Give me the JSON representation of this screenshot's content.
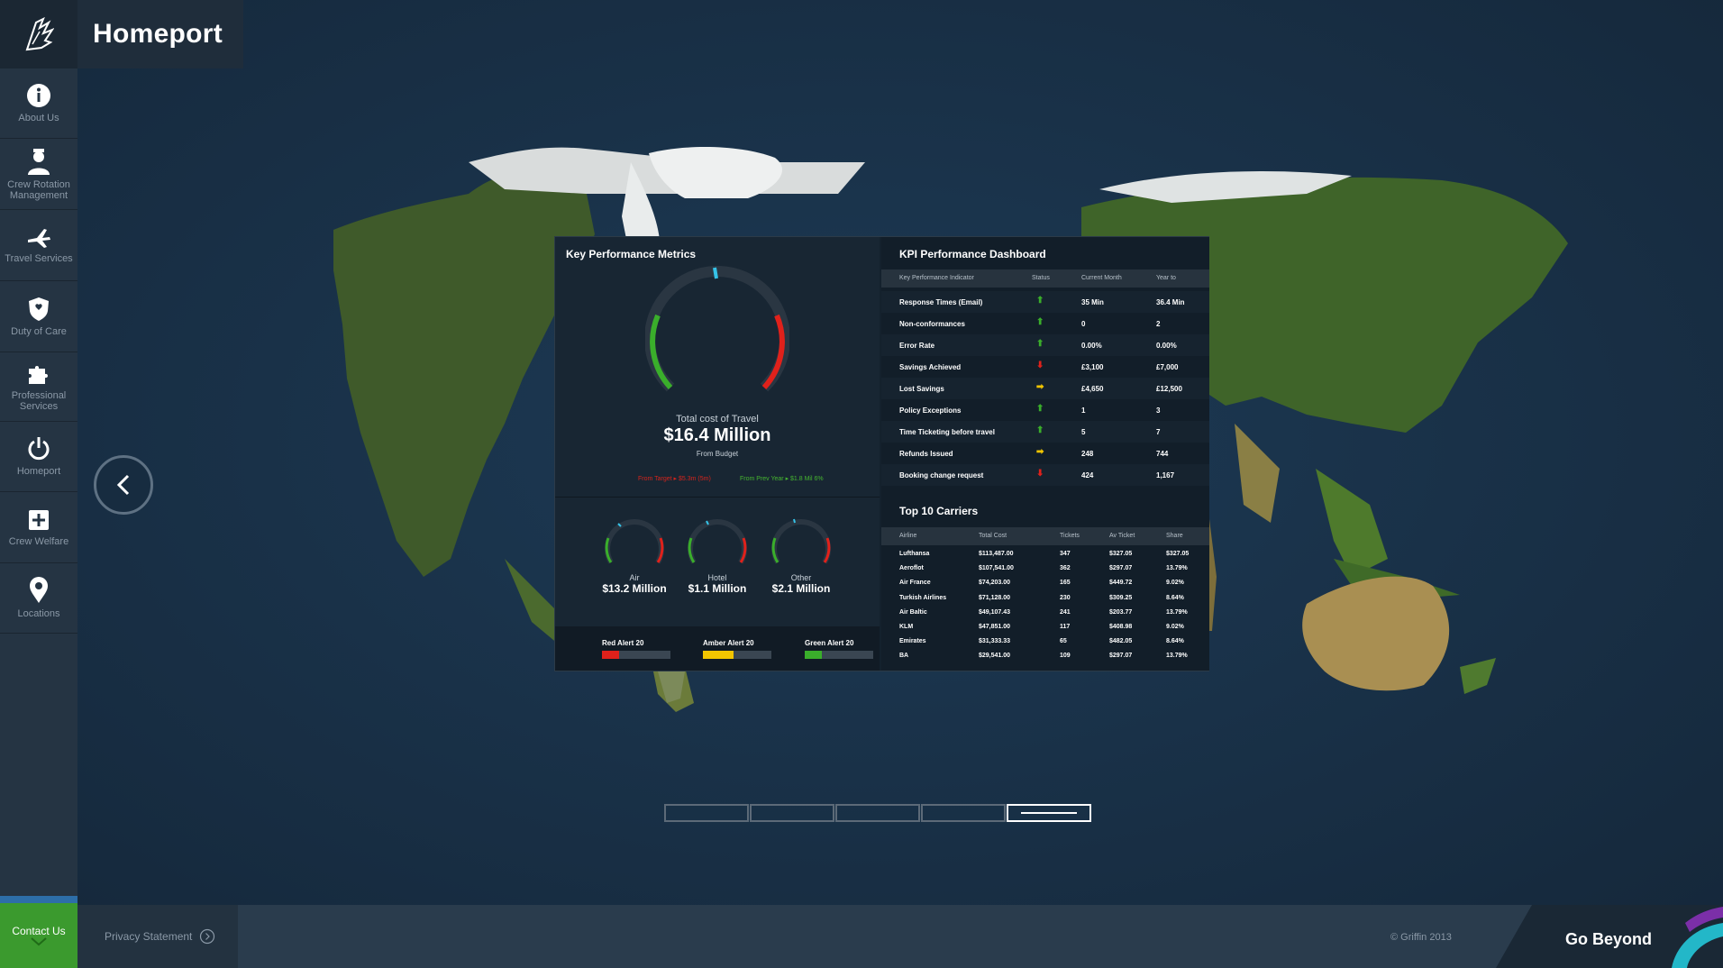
{
  "app": {
    "title": "Homeport"
  },
  "sidebar": {
    "items": [
      {
        "label": "About Us",
        "icon": "info-icon"
      },
      {
        "label": "Crew Rotation Management",
        "icon": "person-icon"
      },
      {
        "label": "Travel Services",
        "icon": "plane-icon"
      },
      {
        "label": "Duty of Care",
        "icon": "shield-icon"
      },
      {
        "label": "Professional Services",
        "icon": "puzzle-icon"
      },
      {
        "label": "Homeport",
        "icon": "power-icon"
      },
      {
        "label": "Crew Welfare",
        "icon": "plus-icon"
      },
      {
        "label": "Locations",
        "icon": "pin-icon"
      }
    ],
    "contact_label": "Contact Us"
  },
  "footer": {
    "privacy": "Privacy Statement",
    "copyright": "© Griffin 2013",
    "tagline": "Go Beyond"
  },
  "kpm": {
    "title": "Key Performance Metrics",
    "total_label": "Total cost of Travel",
    "total_value": "$16.4 Million",
    "from_budget": "From Budget",
    "from_target": "From Target ▸ $5.3m (5m)",
    "from_prev": "From Prev Year ▸ $1.8 Mil 6%",
    "gauges": [
      {
        "label": "Air",
        "value": "$13.2 Million"
      },
      {
        "label": "Hotel",
        "value": "$1.1 Million"
      },
      {
        "label": "Other",
        "value": "$2.1 Million"
      }
    ],
    "alerts": [
      {
        "label": "Red Alert 20",
        "color": "#e0211b",
        "fill": 0.25
      },
      {
        "label": "Amber Alert 20",
        "color": "#f2c500",
        "fill": 0.45
      },
      {
        "label": "Green Alert 20",
        "color": "#3aae2b",
        "fill": 0.25
      }
    ]
  },
  "kpi": {
    "title": "KPI Performance Dashboard",
    "headers": [
      "Key Performance Indicator",
      "Status",
      "Current Month",
      "Year to"
    ],
    "rows": [
      {
        "name": "Response Times (Email)",
        "status": "up",
        "current": "35 Min",
        "ytd": "36.4 Min"
      },
      {
        "name": "Non-conformances",
        "status": "up",
        "current": "0",
        "ytd": "2"
      },
      {
        "name": "Error Rate",
        "status": "up",
        "current": "0.00%",
        "ytd": "0.00%"
      },
      {
        "name": "Savings Achieved",
        "status": "down",
        "current": "£3,100",
        "ytd": "£7,000"
      },
      {
        "name": "Lost Savings",
        "status": "right",
        "current": "£4,650",
        "ytd": "£12,500"
      },
      {
        "name": "Policy Exceptions",
        "status": "up",
        "current": "1",
        "ytd": "3"
      },
      {
        "name": "Time Ticketing before travel",
        "status": "up",
        "current": "5",
        "ytd": "7"
      },
      {
        "name": "Refunds Issued",
        "status": "right",
        "current": "248",
        "ytd": "744"
      },
      {
        "name": "Booking change request",
        "status": "down",
        "current": "424",
        "ytd": "1,167"
      }
    ]
  },
  "carriers": {
    "title": "Top 10 Carriers",
    "headers": [
      "Airline",
      "Total Cost",
      "Tickets",
      "Av Ticket",
      "Share"
    ],
    "rows": [
      [
        "Lufthansa",
        "$113,487.00",
        "347",
        "$327.05",
        "$327.05"
      ],
      [
        "Aeroflot",
        "$107,541.00",
        "362",
        "$297.07",
        "13.79%"
      ],
      [
        "Air France",
        "$74,203.00",
        "165",
        "$449.72",
        "9.02%"
      ],
      [
        "Turkish Airlines",
        "$71,128.00",
        "230",
        "$309.25",
        "8.64%"
      ],
      [
        "Air Baltic",
        "$49,107.43",
        "241",
        "$203.77",
        "13.79%"
      ],
      [
        "KLM",
        "$47,851.00",
        "117",
        "$408.98",
        "9.02%"
      ],
      [
        "Emirates",
        "$31,333.33",
        "65",
        "$482.05",
        "8.64%"
      ],
      [
        "BA",
        "$29,541.00",
        "109",
        "$297.07",
        "13.79%"
      ]
    ]
  },
  "pager": {
    "pages": 5,
    "active": 5
  },
  "colors": {
    "accent_green": "#3b9a2e",
    "alert_red": "#e0211b",
    "alert_amber": "#f2c500",
    "up_green": "#3aae2b"
  }
}
